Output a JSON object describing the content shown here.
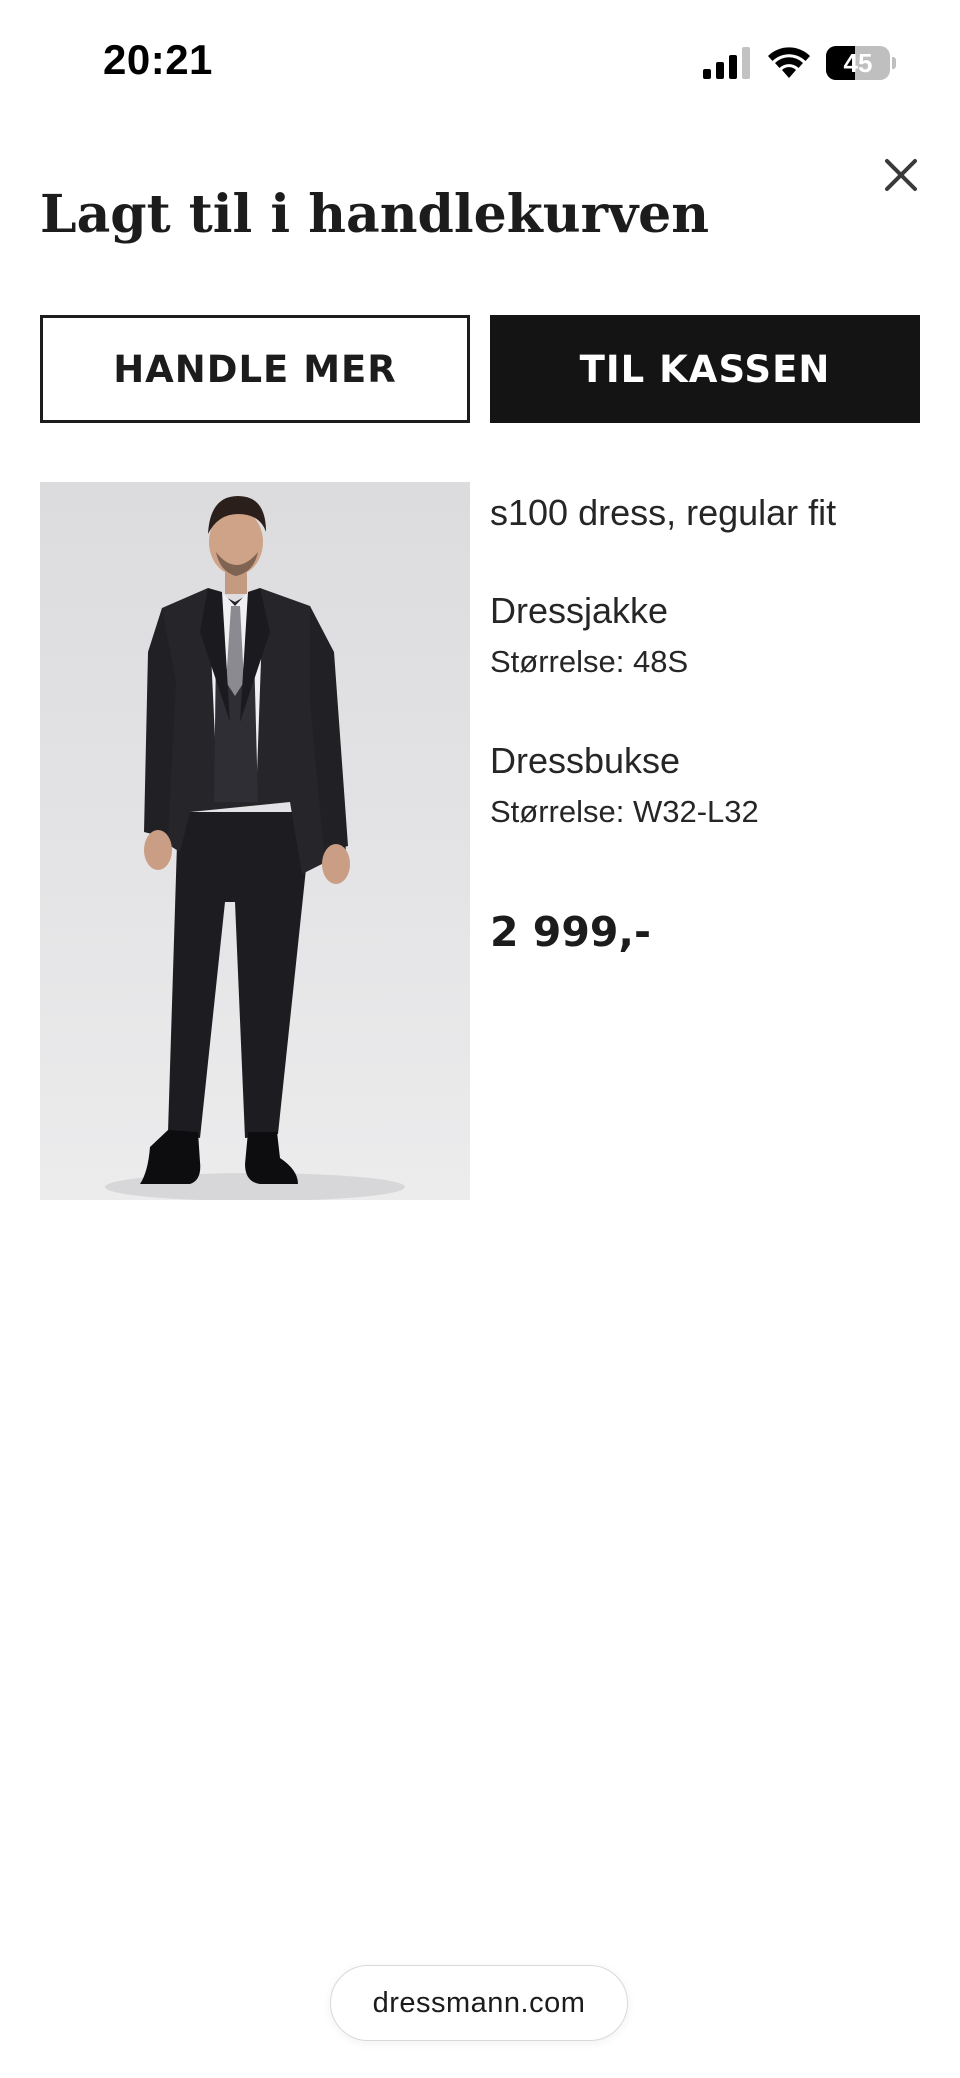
{
  "status_bar": {
    "time": "20:21",
    "battery_level": "45",
    "battery_fraction": 0.45
  },
  "dialog": {
    "title": "Lagt til i handlekurven",
    "close_icon": "close-icon"
  },
  "actions": {
    "continue_label": "HANDLE MER",
    "checkout_label": "TIL KASSEN"
  },
  "product": {
    "name": "s100 dress, regular fit",
    "items": [
      {
        "name": "Dressjakke",
        "size": "Størrelse: 48S"
      },
      {
        "name": "Dressbukse",
        "size": "Størrelse: W32-L32"
      }
    ],
    "price": "2 999,-"
  },
  "browser": {
    "domain": "dressmann.com"
  },
  "colors": {
    "primary_button": "#141414",
    "text": "#1c1c1c",
    "background": "#ffffff"
  }
}
